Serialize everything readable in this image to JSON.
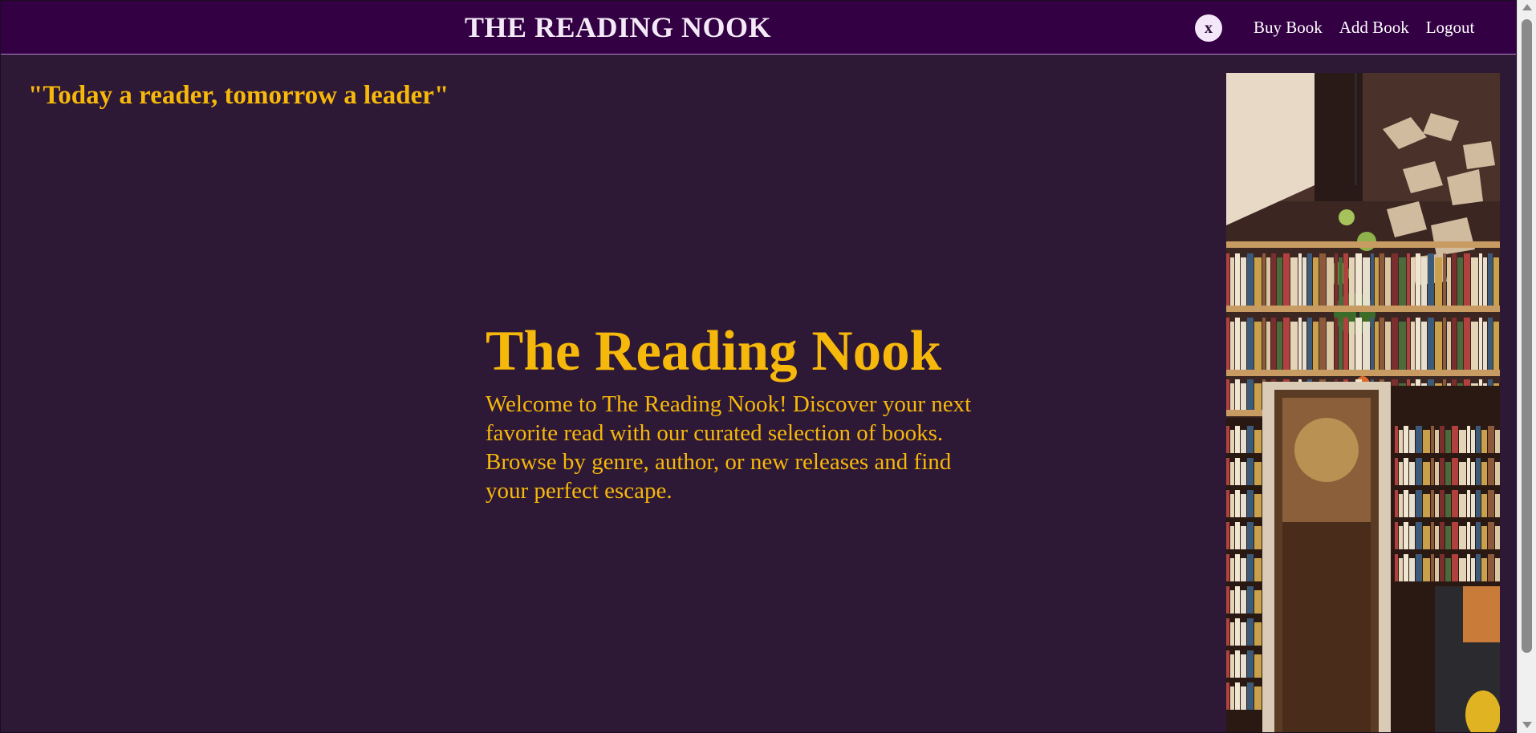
{
  "navbar": {
    "brand": "THE READING NOOK",
    "avatar_initial": "x",
    "links": [
      {
        "label": "Buy Book"
      },
      {
        "label": "Add Book"
      },
      {
        "label": "Logout"
      }
    ]
  },
  "quote": "\"Today a reader, tomorrow a leader\"",
  "hero": {
    "title": "The Reading Nook",
    "text": "Welcome to The Reading Nook! Discover your next favorite read with our curated selection of books. Browse by genre, author, or new releases and find your perfect escape."
  },
  "colors": {
    "background": "#2d1836",
    "navbar": "#330043",
    "accent": "#f6b80b",
    "nav_text": "#ffffff"
  }
}
